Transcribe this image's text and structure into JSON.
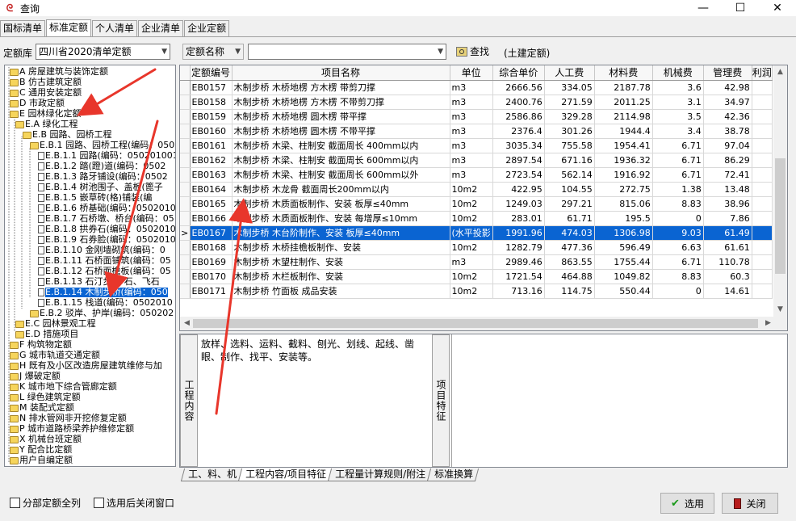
{
  "window": {
    "title": "查询",
    "minimize": "—",
    "maximize": "☐",
    "close": "✕"
  },
  "tabs": [
    "国标清单",
    "标准定额",
    "个人清单",
    "企业清单",
    "企业定额"
  ],
  "toolbar": {
    "library_label": "定额库",
    "library_value": "四川省2020清单定额",
    "field_value": "定额名称",
    "search_value": "",
    "find_label": "查找",
    "scope_label": "(土建定额)"
  },
  "tree": [
    {
      "label": "A 房屋建筑与装饰定额",
      "type": "folder"
    },
    {
      "label": "B 仿古建筑定额",
      "type": "folder"
    },
    {
      "label": "C 通用安装定额",
      "type": "folder"
    },
    {
      "label": "D 市政定额",
      "type": "folder"
    },
    {
      "label": "E 园林绿化定额",
      "type": "folder"
    },
    {
      "label": "E.A 绿化工程",
      "type": "folder"
    },
    {
      "label": "E.B 园路、园桥工程",
      "type": "folder"
    },
    {
      "label": "E.B.1 园路、园桥工程(编码：050",
      "type": "folder"
    },
    {
      "label": "E.B.1.1 园路(编码：050201001",
      "type": "doc"
    },
    {
      "label": "E.B.1.2 踏(蹬)道(编码：0502",
      "type": "doc"
    },
    {
      "label": "E.B.1.3 路牙铺设(编码：0502",
      "type": "doc"
    },
    {
      "label": "E.B.1.4 树池围子、盖板(篦子",
      "type": "doc"
    },
    {
      "label": "E.B.1.5 嵌草砖(格)铺装(编",
      "type": "doc"
    },
    {
      "label": "E.B.1.6 桥基础(编码：0502010",
      "type": "doc"
    },
    {
      "label": "E.B.1.7 石桥墩、桥台(编码：05",
      "type": "doc"
    },
    {
      "label": "E.B.1.8 拱券石(编码：0502010",
      "type": "doc"
    },
    {
      "label": "E.B.1.9 石券脸(编码：0502010",
      "type": "doc"
    },
    {
      "label": "E.B.1.10 金刚墙砌筑(编码：0",
      "type": "doc"
    },
    {
      "label": "E.B.1.11 石桥面铺筑(编码：05",
      "type": "doc"
    },
    {
      "label": "E.B.1.12 石桥面檐板(编码：05",
      "type": "doc"
    },
    {
      "label": "E.B.1.13 石汀步(步石、飞石",
      "type": "doc"
    },
    {
      "label": "E.B.1.14 木制步桥(编码：050",
      "type": "doc",
      "selected": true
    },
    {
      "label": "E.B.1.15 栈道(编码：0502010",
      "type": "doc"
    },
    {
      "label": "E.B.2 驳岸、护岸(编码：050202",
      "type": "folder"
    },
    {
      "label": "E.C 园林景观工程",
      "type": "folder"
    },
    {
      "label": "E.D 措施项目",
      "type": "folder"
    },
    {
      "label": "F 构筑物定额",
      "type": "folder"
    },
    {
      "label": "G 城市轨道交通定额",
      "type": "folder"
    },
    {
      "label": "H 既有及小区改造房屋建筑维修与加",
      "type": "folder"
    },
    {
      "label": "J 爆破定额",
      "type": "folder"
    },
    {
      "label": "K 城市地下综合管廊定额",
      "type": "folder"
    },
    {
      "label": "L 绿色建筑定额",
      "type": "folder"
    },
    {
      "label": "M 装配式定额",
      "type": "folder"
    },
    {
      "label": "N 排水管网非开挖修复定额",
      "type": "folder"
    },
    {
      "label": "P 城市道路桥梁养护维修定额",
      "type": "folder"
    },
    {
      "label": "X 机械台班定额",
      "type": "folder"
    },
    {
      "label": "Y 配合比定额",
      "type": "folder"
    },
    {
      "label": "用户自编定额",
      "type": "folder"
    }
  ],
  "grid": {
    "headers": [
      "定额编号",
      "项目名称",
      "单位",
      "综合单价",
      "人工费",
      "材料费",
      "机械费",
      "管理费",
      "利润"
    ],
    "rows": [
      [
        "EB0157",
        "木制步桥 木桥地楞 方木楞 带剪刀撑",
        "m3",
        "2666.56",
        "334.05",
        "2187.78",
        "3.6",
        "42.98"
      ],
      [
        "EB0158",
        "木制步桥 木桥地楞 方木楞 不带剪刀撑",
        "m3",
        "2400.76",
        "271.59",
        "2011.25",
        "3.1",
        "34.97"
      ],
      [
        "EB0159",
        "木制步桥 木桥地楞 圆木楞 带平撑",
        "m3",
        "2586.86",
        "329.28",
        "2114.98",
        "3.5",
        "42.36"
      ],
      [
        "EB0160",
        "木制步桥 木桥地楞 圆木楞 不带平撑",
        "m3",
        "2376.4",
        "301.26",
        "1944.4",
        "3.4",
        "38.78"
      ],
      [
        "EB0161",
        "木制步桥 木梁、柱制安 截面周长 400mm以内",
        "m3",
        "3035.34",
        "755.58",
        "1954.41",
        "6.71",
        "97.04"
      ],
      [
        "EB0162",
        "木制步桥 木梁、柱制安 截面周长 600mm以内",
        "m3",
        "2897.54",
        "671.16",
        "1936.32",
        "6.71",
        "86.29"
      ],
      [
        "EB0163",
        "木制步桥 木梁、柱制安 截面周长 600mm以外",
        "m3",
        "2723.54",
        "562.14",
        "1916.92",
        "6.71",
        "72.41"
      ],
      [
        "EB0164",
        "木制步桥 木龙骨 截面周长200mm以内",
        "10m2",
        "422.95",
        "104.55",
        "272.75",
        "1.38",
        "13.48"
      ],
      [
        "EB0165",
        "木制步桥 木质面板制作、安装 板厚≤40mm",
        "10m2",
        "1249.03",
        "297.21",
        "815.06",
        "8.83",
        "38.96"
      ],
      [
        "EB0166",
        "木制步桥 木质面板制作、安装 每增厚≤10mm",
        "10m2",
        "283.01",
        "61.71",
        "195.5",
        "0",
        "7.86"
      ],
      [
        "EB0167",
        "木制步桥 木台阶制作、安装 板厚≤40mm",
        "(水平投影",
        "1991.96",
        "474.03",
        "1306.98",
        "9.03",
        "61.49"
      ],
      [
        "EB0168",
        "木制步桥 木桥挂檐板制作、安装",
        "10m2",
        "1282.79",
        "477.36",
        "596.49",
        "6.63",
        "61.61"
      ],
      [
        "EB0169",
        "木制步桥 木望柱制作、安装",
        "m3",
        "2989.46",
        "863.55",
        "1755.44",
        "6.71",
        "110.78"
      ],
      [
        "EB0170",
        "木制步桥 木栏板制作、安装",
        "10m2",
        "1721.54",
        "464.88",
        "1049.82",
        "8.83",
        "60.3"
      ],
      [
        "EB0171",
        "木制步桥 竹面板 成品安装",
        "10m2",
        "713.16",
        "114.75",
        "550.44",
        "0",
        "14.61"
      ]
    ],
    "selected_index": 10
  },
  "content": {
    "label_left": "工程内容",
    "text": "放样、选料、运料、截料、刨光、划线、起线、凿眼、制作、找平、安装等。",
    "label_right": "项目特征"
  },
  "bottom_tabs": [
    "工、料、机",
    "工程内容/项目特征",
    "工程量计算规则/附注",
    "标准换算"
  ],
  "options": {
    "all_sub": "分部定额全列",
    "close_after": "选用后关闭窗口"
  },
  "buttons": {
    "select": "选用",
    "close": "关闭"
  },
  "colors": {
    "selection": "#0a64d2",
    "annotation_arrow": "#e8362b"
  }
}
